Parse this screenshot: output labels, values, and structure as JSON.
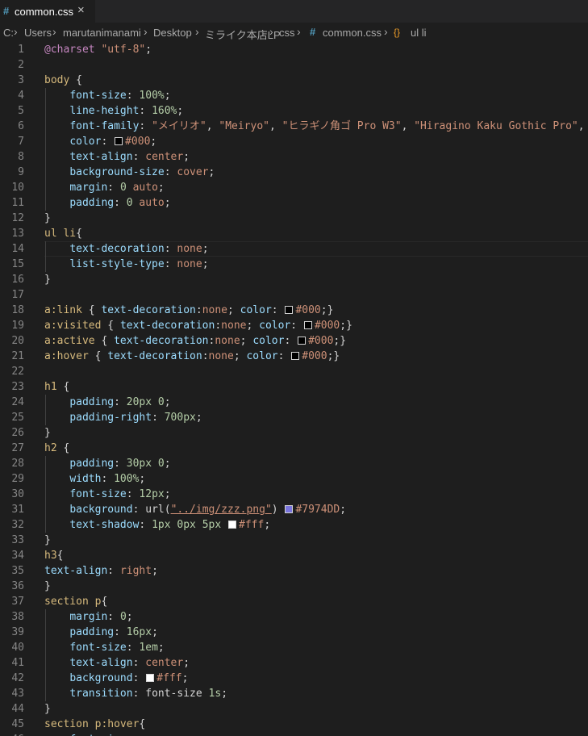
{
  "tab": {
    "icon": "#",
    "name": "common.css",
    "close": "×"
  },
  "breadcrumb": {
    "items": [
      "C:",
      "Users",
      "marutanimanami",
      "Desktop",
      "ミライク本店LP",
      "css",
      "common.css",
      "ul li"
    ],
    "file_icon": "#",
    "symbol_icon": "{}"
  },
  "colors": {
    "black": "#000000",
    "white": "#ffffff",
    "purple": "#7974DD"
  },
  "lines": [
    {
      "n": "1",
      "toks": [
        [
          "at",
          "@charset"
        ],
        [
          "pun",
          " "
        ],
        [
          "str",
          "\"utf-8\""
        ],
        [
          "pun",
          ";"
        ]
      ]
    },
    {
      "n": "2",
      "toks": []
    },
    {
      "n": "3",
      "toks": [
        [
          "tag",
          "body"
        ],
        [
          "pun",
          " {"
        ]
      ]
    },
    {
      "n": "4",
      "toks": [
        [
          "pun",
          "    "
        ],
        [
          "prop",
          "font-size"
        ],
        [
          "pun",
          ": "
        ],
        [
          "num",
          "100%"
        ],
        [
          "pun",
          ";"
        ]
      ]
    },
    {
      "n": "5",
      "toks": [
        [
          "pun",
          "    "
        ],
        [
          "prop",
          "line-height"
        ],
        [
          "pun",
          ": "
        ],
        [
          "num",
          "160%"
        ],
        [
          "pun",
          ";"
        ]
      ]
    },
    {
      "n": "6",
      "toks": [
        [
          "pun",
          "    "
        ],
        [
          "prop",
          "font-family"
        ],
        [
          "pun",
          ": "
        ],
        [
          "str",
          "\"メイリオ\""
        ],
        [
          "pun",
          ", "
        ],
        [
          "str",
          "\"Meiryo\""
        ],
        [
          "pun",
          ", "
        ],
        [
          "str",
          "\"ヒラギノ角ゴ Pro W3\""
        ],
        [
          "pun",
          ", "
        ],
        [
          "str",
          "\"Hiragino Kaku Gothic Pro\""
        ],
        [
          "pun",
          ","
        ]
      ]
    },
    {
      "n": "7",
      "toks": [
        [
          "pun",
          "    "
        ],
        [
          "prop",
          "color"
        ],
        [
          "pun",
          ": "
        ],
        [
          "sw",
          "black"
        ],
        [
          "kw",
          "#000"
        ],
        [
          "pun",
          ";"
        ]
      ]
    },
    {
      "n": "8",
      "toks": [
        [
          "pun",
          "    "
        ],
        [
          "prop",
          "text-align"
        ],
        [
          "pun",
          ": "
        ],
        [
          "kw",
          "center"
        ],
        [
          "pun",
          ";"
        ]
      ]
    },
    {
      "n": "9",
      "toks": [
        [
          "pun",
          "    "
        ],
        [
          "prop",
          "background-size"
        ],
        [
          "pun",
          ": "
        ],
        [
          "kw",
          "cover"
        ],
        [
          "pun",
          ";"
        ]
      ]
    },
    {
      "n": "10",
      "toks": [
        [
          "pun",
          "    "
        ],
        [
          "prop",
          "margin"
        ],
        [
          "pun",
          ": "
        ],
        [
          "num",
          "0"
        ],
        [
          "pun",
          " "
        ],
        [
          "kw",
          "auto"
        ],
        [
          "pun",
          ";"
        ]
      ]
    },
    {
      "n": "11",
      "toks": [
        [
          "pun",
          "    "
        ],
        [
          "prop",
          "padding"
        ],
        [
          "pun",
          ": "
        ],
        [
          "num",
          "0"
        ],
        [
          "pun",
          " "
        ],
        [
          "kw",
          "auto"
        ],
        [
          "pun",
          ";"
        ]
      ]
    },
    {
      "n": "12",
      "toks": [
        [
          "pun",
          "}"
        ]
      ]
    },
    {
      "n": "13",
      "toks": [
        [
          "tag",
          "ul li"
        ],
        [
          "pun",
          "{"
        ]
      ]
    },
    {
      "n": "14",
      "toks": [
        [
          "pun",
          "    "
        ],
        [
          "prop",
          "text-decoration"
        ],
        [
          "pun",
          ": "
        ],
        [
          "kw",
          "none"
        ],
        [
          "pun",
          ";"
        ]
      ]
    },
    {
      "n": "15",
      "toks": [
        [
          "pun",
          "    "
        ],
        [
          "prop",
          "list-style-type"
        ],
        [
          "pun",
          ": "
        ],
        [
          "kw",
          "none"
        ],
        [
          "pun",
          ";"
        ]
      ]
    },
    {
      "n": "16",
      "toks": [
        [
          "pun",
          "}"
        ]
      ]
    },
    {
      "n": "17",
      "toks": []
    },
    {
      "n": "18",
      "toks": [
        [
          "sel",
          "a:link"
        ],
        [
          "pun",
          " { "
        ],
        [
          "prop",
          "text-decoration"
        ],
        [
          "pun",
          ":"
        ],
        [
          "kw",
          "none"
        ],
        [
          "pun",
          "; "
        ],
        [
          "prop",
          "color"
        ],
        [
          "pun",
          ": "
        ],
        [
          "sw",
          "black"
        ],
        [
          "kw",
          "#000"
        ],
        [
          "pun",
          ";}"
        ]
      ]
    },
    {
      "n": "19",
      "toks": [
        [
          "sel",
          "a:visited"
        ],
        [
          "pun",
          " { "
        ],
        [
          "prop",
          "text-decoration"
        ],
        [
          "pun",
          ":"
        ],
        [
          "kw",
          "none"
        ],
        [
          "pun",
          "; "
        ],
        [
          "prop",
          "color"
        ],
        [
          "pun",
          ": "
        ],
        [
          "sw",
          "black"
        ],
        [
          "kw",
          "#000"
        ],
        [
          "pun",
          ";}"
        ]
      ]
    },
    {
      "n": "20",
      "toks": [
        [
          "sel",
          "a:active"
        ],
        [
          "pun",
          " { "
        ],
        [
          "prop",
          "text-decoration"
        ],
        [
          "pun",
          ":"
        ],
        [
          "kw",
          "none"
        ],
        [
          "pun",
          "; "
        ],
        [
          "prop",
          "color"
        ],
        [
          "pun",
          ": "
        ],
        [
          "sw",
          "black"
        ],
        [
          "kw",
          "#000"
        ],
        [
          "pun",
          ";}"
        ]
      ]
    },
    {
      "n": "21",
      "toks": [
        [
          "sel",
          "a:hover"
        ],
        [
          "pun",
          " { "
        ],
        [
          "prop",
          "text-decoration"
        ],
        [
          "pun",
          ":"
        ],
        [
          "kw",
          "none"
        ],
        [
          "pun",
          "; "
        ],
        [
          "prop",
          "color"
        ],
        [
          "pun",
          ": "
        ],
        [
          "sw",
          "black"
        ],
        [
          "kw",
          "#000"
        ],
        [
          "pun",
          ";}"
        ]
      ]
    },
    {
      "n": "22",
      "toks": []
    },
    {
      "n": "23",
      "toks": [
        [
          "tag",
          "h1"
        ],
        [
          "pun",
          " {"
        ]
      ]
    },
    {
      "n": "24",
      "toks": [
        [
          "pun",
          "    "
        ],
        [
          "prop",
          "padding"
        ],
        [
          "pun",
          ": "
        ],
        [
          "num",
          "20px"
        ],
        [
          "pun",
          " "
        ],
        [
          "num",
          "0"
        ],
        [
          "pun",
          ";"
        ]
      ]
    },
    {
      "n": "25",
      "toks": [
        [
          "pun",
          "    "
        ],
        [
          "prop",
          "padding-right"
        ],
        [
          "pun",
          ": "
        ],
        [
          "num",
          "700px"
        ],
        [
          "pun",
          ";"
        ]
      ]
    },
    {
      "n": "26",
      "toks": [
        [
          "pun",
          "}"
        ]
      ]
    },
    {
      "n": "27",
      "toks": [
        [
          "tag",
          "h2"
        ],
        [
          "pun",
          " {"
        ]
      ]
    },
    {
      "n": "28",
      "toks": [
        [
          "pun",
          "    "
        ],
        [
          "prop",
          "padding"
        ],
        [
          "pun",
          ": "
        ],
        [
          "num",
          "30px"
        ],
        [
          "pun",
          " "
        ],
        [
          "num",
          "0"
        ],
        [
          "pun",
          ";"
        ]
      ]
    },
    {
      "n": "29",
      "toks": [
        [
          "pun",
          "    "
        ],
        [
          "prop",
          "width"
        ],
        [
          "pun",
          ": "
        ],
        [
          "num",
          "100%"
        ],
        [
          "pun",
          ";"
        ]
      ]
    },
    {
      "n": "30",
      "toks": [
        [
          "pun",
          "    "
        ],
        [
          "prop",
          "font-size"
        ],
        [
          "pun",
          ": "
        ],
        [
          "num",
          "12px"
        ],
        [
          "pun",
          ";"
        ]
      ]
    },
    {
      "n": "31",
      "toks": [
        [
          "pun",
          "    "
        ],
        [
          "prop",
          "background"
        ],
        [
          "pun",
          ": "
        ],
        [
          "pun",
          "url("
        ],
        [
          "url",
          "\"../img/zzz.png\""
        ],
        [
          "pun",
          ") "
        ],
        [
          "sw",
          "purple"
        ],
        [
          "kw",
          "#7974DD"
        ],
        [
          "pun",
          ";"
        ]
      ]
    },
    {
      "n": "32",
      "toks": [
        [
          "pun",
          "    "
        ],
        [
          "prop",
          "text-shadow"
        ],
        [
          "pun",
          ": "
        ],
        [
          "num",
          "1px"
        ],
        [
          "pun",
          " "
        ],
        [
          "num",
          "0px"
        ],
        [
          "pun",
          " "
        ],
        [
          "num",
          "5px"
        ],
        [
          "pun",
          " "
        ],
        [
          "sw",
          "white"
        ],
        [
          "kw",
          "#fff"
        ],
        [
          "pun",
          ";"
        ]
      ]
    },
    {
      "n": "33",
      "toks": [
        [
          "pun",
          "}"
        ]
      ]
    },
    {
      "n": "34",
      "toks": [
        [
          "tag",
          "h3"
        ],
        [
          "pun",
          "{"
        ]
      ]
    },
    {
      "n": "35",
      "toks": [
        [
          "prop",
          "text-align"
        ],
        [
          "pun",
          ": "
        ],
        [
          "kw",
          "right"
        ],
        [
          "pun",
          ";"
        ]
      ]
    },
    {
      "n": "36",
      "toks": [
        [
          "pun",
          "}"
        ]
      ]
    },
    {
      "n": "37",
      "toks": [
        [
          "tag",
          "section p"
        ],
        [
          "pun",
          "{"
        ]
      ]
    },
    {
      "n": "38",
      "toks": [
        [
          "pun",
          "    "
        ],
        [
          "prop",
          "margin"
        ],
        [
          "pun",
          ": "
        ],
        [
          "num",
          "0"
        ],
        [
          "pun",
          ";"
        ]
      ]
    },
    {
      "n": "39",
      "toks": [
        [
          "pun",
          "    "
        ],
        [
          "prop",
          "padding"
        ],
        [
          "pun",
          ": "
        ],
        [
          "num",
          "16px"
        ],
        [
          "pun",
          ";"
        ]
      ]
    },
    {
      "n": "40",
      "toks": [
        [
          "pun",
          "    "
        ],
        [
          "prop",
          "font-size"
        ],
        [
          "pun",
          ": "
        ],
        [
          "num",
          "1em"
        ],
        [
          "pun",
          ";"
        ]
      ]
    },
    {
      "n": "41",
      "toks": [
        [
          "pun",
          "    "
        ],
        [
          "prop",
          "text-align"
        ],
        [
          "pun",
          ": "
        ],
        [
          "kw",
          "center"
        ],
        [
          "pun",
          ";"
        ]
      ]
    },
    {
      "n": "42",
      "toks": [
        [
          "pun",
          "    "
        ],
        [
          "prop",
          "background"
        ],
        [
          "pun",
          ": "
        ],
        [
          "sw",
          "white"
        ],
        [
          "kw",
          "#fff"
        ],
        [
          "pun",
          ";"
        ]
      ]
    },
    {
      "n": "43",
      "toks": [
        [
          "pun",
          "    "
        ],
        [
          "prop",
          "transition"
        ],
        [
          "pun",
          ": "
        ],
        [
          "pun",
          "font-size "
        ],
        [
          "num",
          "1s"
        ],
        [
          "pun",
          ";"
        ]
      ]
    },
    {
      "n": "44",
      "toks": [
        [
          "pun",
          "}"
        ]
      ]
    },
    {
      "n": "45",
      "toks": [
        [
          "tag",
          "section p:hover"
        ],
        [
          "pun",
          "{"
        ]
      ]
    },
    {
      "n": "46",
      "toks": [
        [
          "pun",
          "    "
        ],
        [
          "prop",
          "font-size"
        ],
        [
          "pun",
          ": "
        ]
      ]
    }
  ]
}
